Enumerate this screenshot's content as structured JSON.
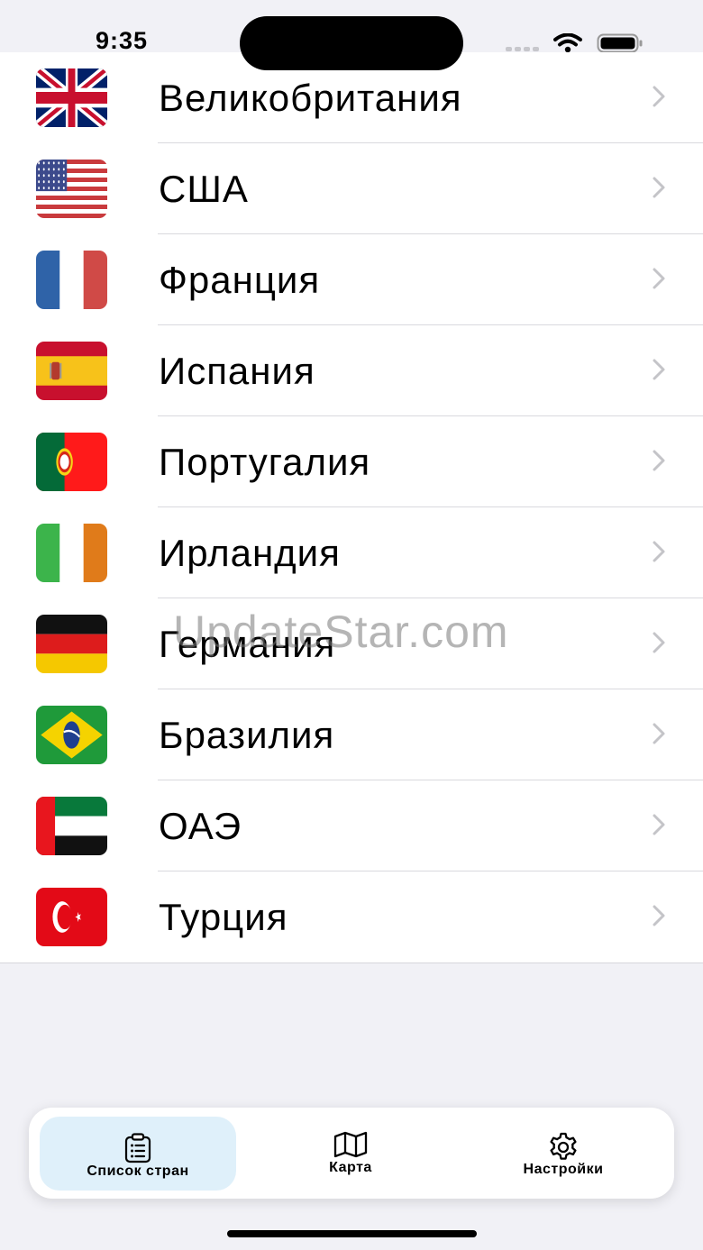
{
  "status": {
    "time": "9:35"
  },
  "countries": [
    {
      "name": "Великобритания",
      "flag": "uk-flag-icon"
    },
    {
      "name": "США",
      "flag": "usa-flag-icon"
    },
    {
      "name": "Франция",
      "flag": "france-flag-icon"
    },
    {
      "name": "Испания",
      "flag": "spain-flag-icon"
    },
    {
      "name": "Португалия",
      "flag": "portugal-flag-icon"
    },
    {
      "name": "Ирландия",
      "flag": "ireland-flag-icon"
    },
    {
      "name": "Германия",
      "flag": "germany-flag-icon"
    },
    {
      "name": "Бразилия",
      "flag": "brazil-flag-icon"
    },
    {
      "name": "ОАЭ",
      "flag": "uae-flag-icon"
    },
    {
      "name": "Турция",
      "flag": "turkey-flag-icon"
    }
  ],
  "watermark": "UpdateStar.com",
  "tabs": [
    {
      "label": "Список стран",
      "icon": "clipboard-list-icon",
      "active": true
    },
    {
      "label": "Карта",
      "icon": "map-icon",
      "active": false
    },
    {
      "label": "Настройки",
      "icon": "gear-icon",
      "active": false
    }
  ],
  "colors": {
    "background": "#f1f1f6",
    "active_tab": "#dff0fa",
    "chevron": "#c4c4c8"
  }
}
